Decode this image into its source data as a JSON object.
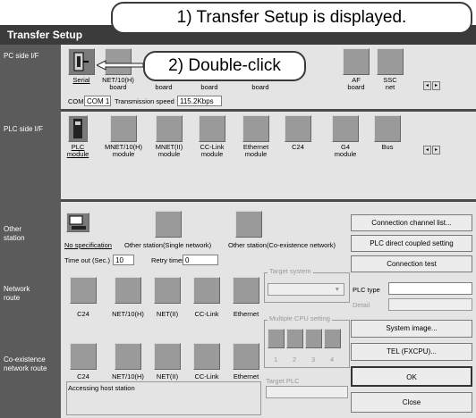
{
  "window": {
    "title": "Transfer Setup"
  },
  "callouts": {
    "step1": "1) Transfer Setup is displayed.",
    "step2": "2) Double-click"
  },
  "row_labels": {
    "pc_side": "PC side I/F",
    "plc_side": "PLC side I/F",
    "other_station": [
      "Other",
      "station"
    ],
    "network_route": [
      "Network",
      "route"
    ],
    "coexistence_route": [
      "Co-existence",
      "network route"
    ]
  },
  "pc_side": {
    "items": [
      "Serial",
      "NET/10(H)",
      "AF",
      "SSC"
    ],
    "items_line2": [
      "",
      "board",
      "board",
      "net"
    ],
    "hidden_labels": [
      "board",
      "board",
      "board"
    ],
    "com_label": "COM",
    "com_value": "COM 1",
    "speed_label": "Transmission speed",
    "speed_value": "115.2Kbps"
  },
  "plc_side": {
    "items": [
      "PLC",
      "MNET/10(H)",
      "MNET(II)",
      "CC-Link",
      "Ethernet",
      "C24",
      "G4",
      "Bus"
    ],
    "items_line2": [
      "module",
      "module",
      "module",
      "module",
      "module",
      "",
      "module",
      ""
    ]
  },
  "other_station": {
    "items": [
      "No specification",
      "Other station(Single network)",
      "Other station(Co-existence network)"
    ],
    "timeout_label": "Time out (Sec.)",
    "timeout_value": "10",
    "retry_label": "Retry times",
    "retry_value": "0"
  },
  "network_route": {
    "items": [
      "C24",
      "NET/10(H)",
      "NET(II)",
      "CC-Link",
      "Ethernet"
    ]
  },
  "coexistence_route": {
    "items": [
      "C24",
      "NET/10(H)",
      "NET(II)",
      "CC-Link",
      "Ethernet"
    ],
    "status": "Accessing host station"
  },
  "target_system": {
    "label": "Target system",
    "value": ""
  },
  "multi_cpu": {
    "label": "Multiple CPU setting",
    "numbers": [
      "1",
      "2",
      "3",
      "4"
    ]
  },
  "target_plc": {
    "label": "Target PLC",
    "value": ""
  },
  "plc_type": {
    "label": "PLC type",
    "value": ""
  },
  "detail": {
    "label": "Detail",
    "value": ""
  },
  "buttons": {
    "connection_channel_list": "Connection channel list...",
    "plc_direct": "PLC direct coupled setting",
    "connection_test": "Connection test",
    "system_image": "System image...",
    "tel": "TEL (FXCPU)...",
    "ok": "OK",
    "close": "Close"
  }
}
